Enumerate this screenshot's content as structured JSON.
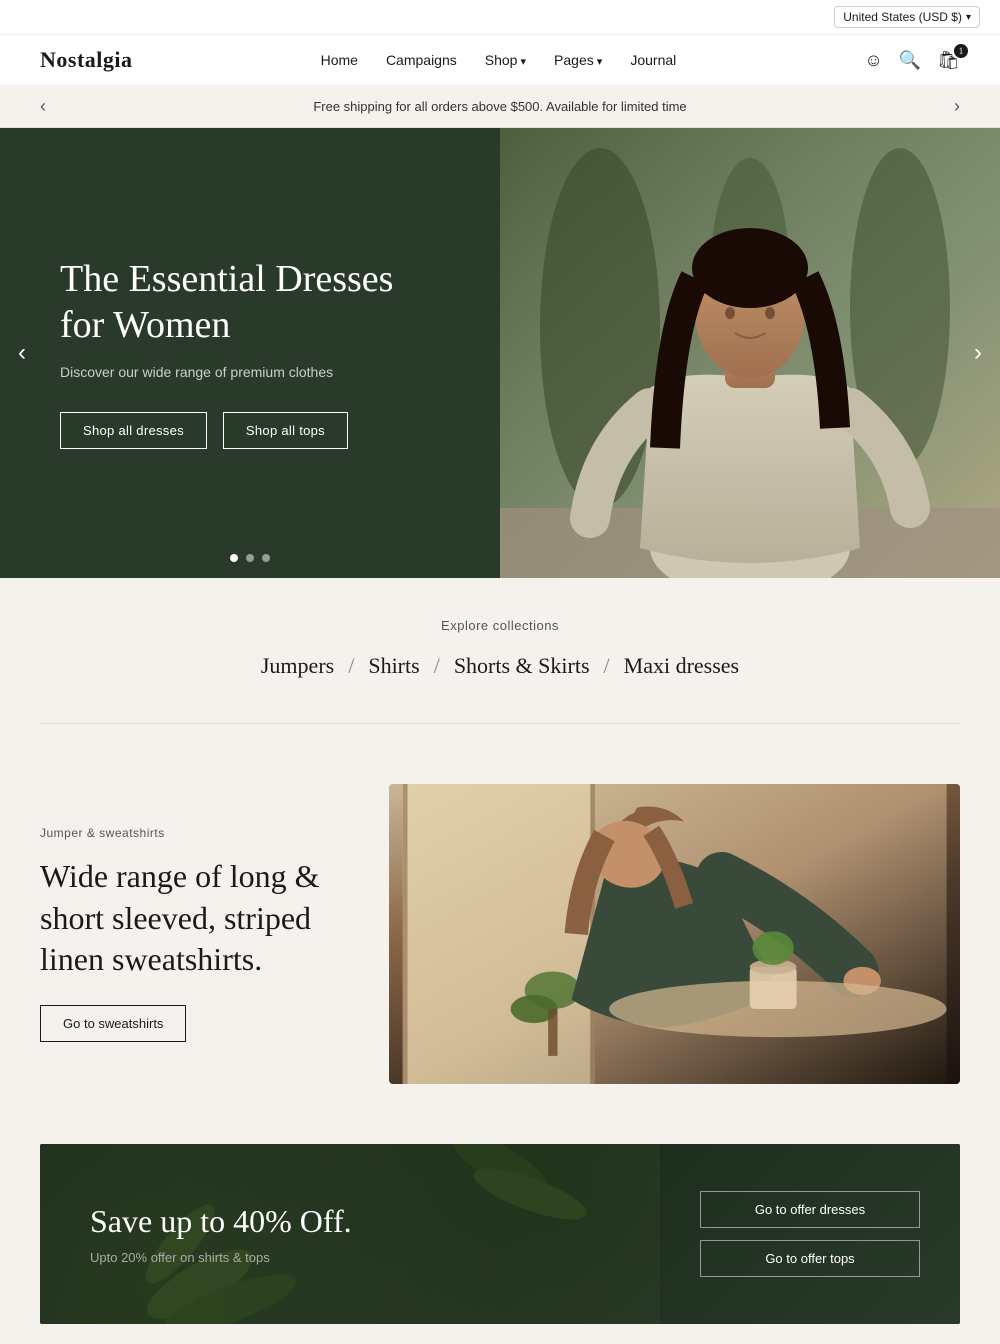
{
  "topbar": {
    "currency": "United States (USD $)",
    "chevron": "▾"
  },
  "header": {
    "logo": "Nostalgia",
    "nav": [
      {
        "label": "Home",
        "hasDropdown": false
      },
      {
        "label": "Campaigns",
        "hasDropdown": false
      },
      {
        "label": "Shop",
        "hasDropdown": true
      },
      {
        "label": "Pages",
        "hasDropdown": true
      },
      {
        "label": "Journal",
        "hasDropdown": false
      }
    ],
    "cartCount": "1"
  },
  "announcement": {
    "text": "Free shipping for all orders above $500. Available for limited time"
  },
  "hero": {
    "title": "The Essential Dresses for Women",
    "subtitle": "Discover our wide range of premium clothes",
    "btn1": "Shop all dresses",
    "btn2": "Shop all tops",
    "dots": [
      {
        "active": true
      },
      {
        "active": false
      },
      {
        "active": false
      }
    ]
  },
  "collections": {
    "label": "Explore collections",
    "items": [
      {
        "label": "Jumpers"
      },
      {
        "sep": "/"
      },
      {
        "label": "Shirts"
      },
      {
        "sep": "/"
      },
      {
        "label": "Shorts & Skirts"
      },
      {
        "sep": "/"
      },
      {
        "label": "Maxi dresses"
      }
    ]
  },
  "sweatshirts": {
    "category": "Jumper & sweatshirts",
    "title": "Wide range of long & short sleeved, striped linen sweatshirts.",
    "btn": "Go to sweatshirts"
  },
  "offer": {
    "title": "Save up to 40% Off.",
    "subtitle": "Upto 20% offer on shirts & tops",
    "btn1": "Go to offer dresses",
    "btn2": "Go to offer tops"
  }
}
